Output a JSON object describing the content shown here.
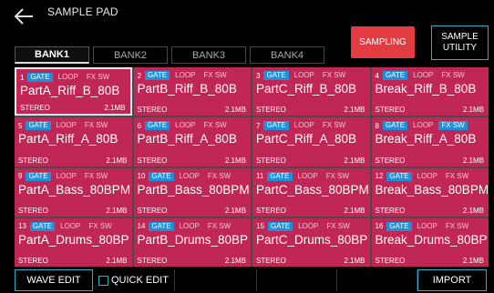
{
  "header": {
    "title": "SAMPLE PAD"
  },
  "bank_tabs": [
    "BANK1",
    "BANK2",
    "BANK3",
    "BANK4"
  ],
  "buttons": {
    "sampling": "SAMPLING",
    "utility_line1": "SAMPLE",
    "utility_line2": "UTILITY"
  },
  "labels": {
    "gate": "GATE",
    "loop": "LOOP",
    "fx": "FX SW",
    "stereo": "STEREO"
  },
  "pads": [
    {
      "num": "1",
      "name": "PartA_Riff_B_80B",
      "size": "2.1MB"
    },
    {
      "num": "2",
      "name": "PartB_Riff_B_80B",
      "size": "2.1MB"
    },
    {
      "num": "3",
      "name": "PartC_Riff_B_80B",
      "size": "2.1MB"
    },
    {
      "num": "4",
      "name": "Break_Riff_B_80B",
      "size": "2.1MB"
    },
    {
      "num": "5",
      "name": "PartA_Riff_A_80B",
      "size": "2.1MB"
    },
    {
      "num": "6",
      "name": "PartB_Riff_A_80B",
      "size": "2.1MB"
    },
    {
      "num": "7",
      "name": "PartC_Riff_A_80B",
      "size": "2.1MB"
    },
    {
      "num": "8",
      "name": "Break_Riff_A_80B",
      "size": "2.1MB"
    },
    {
      "num": "9",
      "name": "PartA_Bass_80BPM",
      "size": "2.1MB"
    },
    {
      "num": "10",
      "name": "PartB_Bass_80BPM",
      "size": "2.1MB"
    },
    {
      "num": "11",
      "name": "PartC_Bass_80BPM",
      "size": "2.1MB"
    },
    {
      "num": "12",
      "name": "Break_Bass_80BPM",
      "size": "2.1MB"
    },
    {
      "num": "13",
      "name": "PartA_Drums_80BP",
      "size": "2.1MB"
    },
    {
      "num": "14",
      "name": "PartB_Drums_80BP",
      "size": "2.1MB"
    },
    {
      "num": "15",
      "name": "PartC_Drums_80BP",
      "size": "2.1MB"
    },
    {
      "num": "16",
      "name": "Break_Drums_80BP",
      "size": "2.1MB"
    }
  ],
  "bottom": {
    "wave_edit": "WAVE EDIT",
    "quick_edit": "QUICK EDIT",
    "import": "IMPORT"
  },
  "colors": {
    "pad": "#c02656",
    "accent": "#27b0c8",
    "sampling": "#e33b42",
    "gate": "#1f8fd8"
  },
  "icons": {
    "back": "back-arrow-icon",
    "checkbox": "checkbox-icon"
  }
}
